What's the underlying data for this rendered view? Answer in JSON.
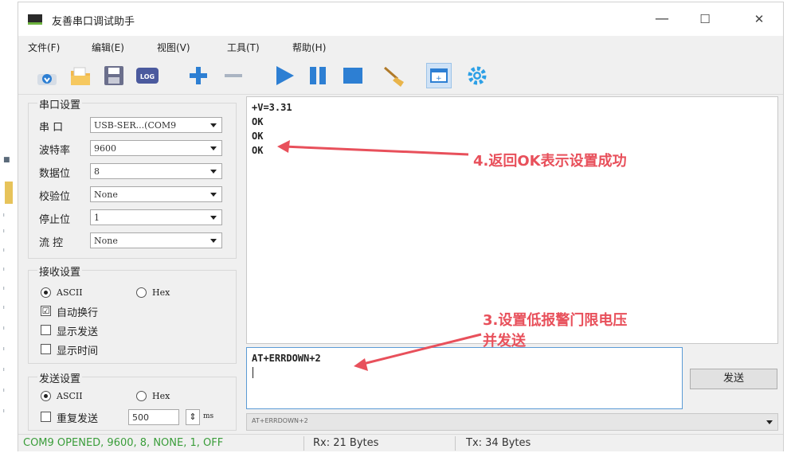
{
  "window": {
    "title": "友善串口调试助手",
    "minimize": "—",
    "maximize": "☐",
    "close": "✕"
  },
  "menu": [
    "文件(F)",
    "编辑(E)",
    "视图(V)",
    "工具(T)",
    "帮助(H)"
  ],
  "toolbar_icons": [
    "download-icon",
    "open-folder-icon",
    "save-icon",
    "log-icon",
    "add-icon",
    "remove-icon",
    "play-icon",
    "pause-icon",
    "stop-icon",
    "clear-broom-icon",
    "new-window-icon",
    "settings-gear-icon"
  ],
  "serial_settings": {
    "title": "串口设置",
    "port_label": "串 口",
    "port_value": "USB-SER...(COM9",
    "baud_label": "波特率",
    "baud_value": "9600",
    "databits_label": "数据位",
    "databits_value": "8",
    "parity_label": "校验位",
    "parity_value": "None",
    "stopbits_label": "停止位",
    "stopbits_value": "1",
    "flow_label": "流 控",
    "flow_value": "None"
  },
  "receive_settings": {
    "title": "接收设置",
    "ascii_label": "ASCII",
    "hex_label": "Hex",
    "auto_newline": "自动换行",
    "show_send": "显示发送",
    "show_time": "显示时间",
    "auto_newline_checked": "☑"
  },
  "send_settings": {
    "title": "发送设置",
    "ascii_label": "ASCII",
    "hex_label": "Hex",
    "repeat_label": "重复发送",
    "repeat_value": "500",
    "repeat_unit": "ms",
    "stepper": "⇕"
  },
  "receive_area": {
    "lines": [
      "+V=3.31",
      "OK",
      "OK",
      "OK"
    ]
  },
  "send_area": {
    "text": "AT+ERRDOWN+2"
  },
  "send_button": "发送",
  "history_text": "AT+ERRDOWN+2",
  "status": {
    "port_status": "COM9 OPENED, 9600, 8, NONE, 1, OFF",
    "rx": "Rx: 21 Bytes",
    "tx": "Tx: 34 Bytes"
  },
  "annotations": {
    "step4": "4.返回OK表示设置成功",
    "step3_line1": "3.设置低报警门限电压",
    "step3_line2": "并发送"
  },
  "colors": {
    "annotation": "#e8505b",
    "status_text": "#3a9d3a",
    "send_border": "#5b9bd5"
  }
}
